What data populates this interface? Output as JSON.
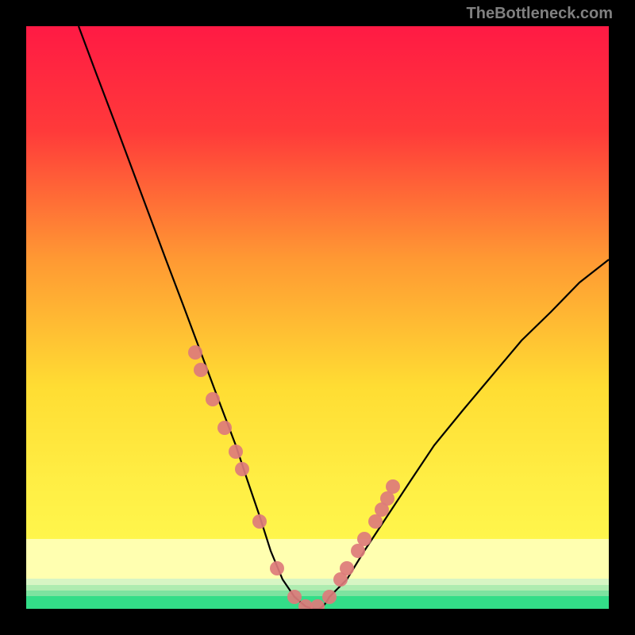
{
  "watermark": "TheBottleneck.com",
  "chart_data": {
    "type": "line",
    "title": "",
    "xlabel": "",
    "ylabel": "",
    "xlim": [
      0,
      100
    ],
    "ylim": [
      0,
      100
    ],
    "background_gradient": {
      "top": "#ff1a44",
      "mid1": "#ff9933",
      "mid2": "#ffee33",
      "mid3": "#ffff99",
      "bottom": "#33dd88"
    },
    "series": [
      {
        "name": "bottleneck-curve",
        "type": "line",
        "color": "#000000",
        "x": [
          9,
          12,
          15,
          18,
          21,
          24,
          27,
          30,
          33,
          36,
          38,
          40,
          42,
          44,
          46,
          48,
          50,
          52,
          55,
          58,
          62,
          66,
          70,
          75,
          80,
          85,
          90,
          95,
          100
        ],
        "y": [
          100,
          92,
          84,
          76,
          68,
          60,
          52,
          44,
          36,
          28,
          22,
          16,
          10,
          5,
          2,
          0.5,
          0.5,
          2,
          5,
          10,
          16,
          22,
          28,
          34,
          40,
          46,
          51,
          56,
          60
        ]
      },
      {
        "name": "highlight-markers",
        "type": "scatter",
        "color": "#e06666",
        "x": [
          29,
          30,
          32,
          34,
          36,
          37,
          40,
          43,
          46,
          48,
          50,
          52,
          54,
          55,
          57,
          58,
          60,
          61,
          62,
          63
        ],
        "y": [
          44,
          41,
          36,
          31,
          27,
          24,
          15,
          7,
          2,
          0.5,
          0.5,
          2,
          5,
          7,
          10,
          12,
          15,
          17,
          19,
          21
        ]
      }
    ],
    "bands": [
      {
        "y_from": 0,
        "y_to": 2.5,
        "color": "#33dd88"
      },
      {
        "y_from": 2.5,
        "y_to": 3.2,
        "color": "#66e699"
      },
      {
        "y_from": 3.2,
        "y_to": 4.0,
        "color": "#99eeaa"
      },
      {
        "y_from": 4.0,
        "y_to": 5.0,
        "color": "#ccf5bb"
      },
      {
        "y_from": 5.0,
        "y_to": 12,
        "color": "#ffffcc"
      }
    ]
  }
}
